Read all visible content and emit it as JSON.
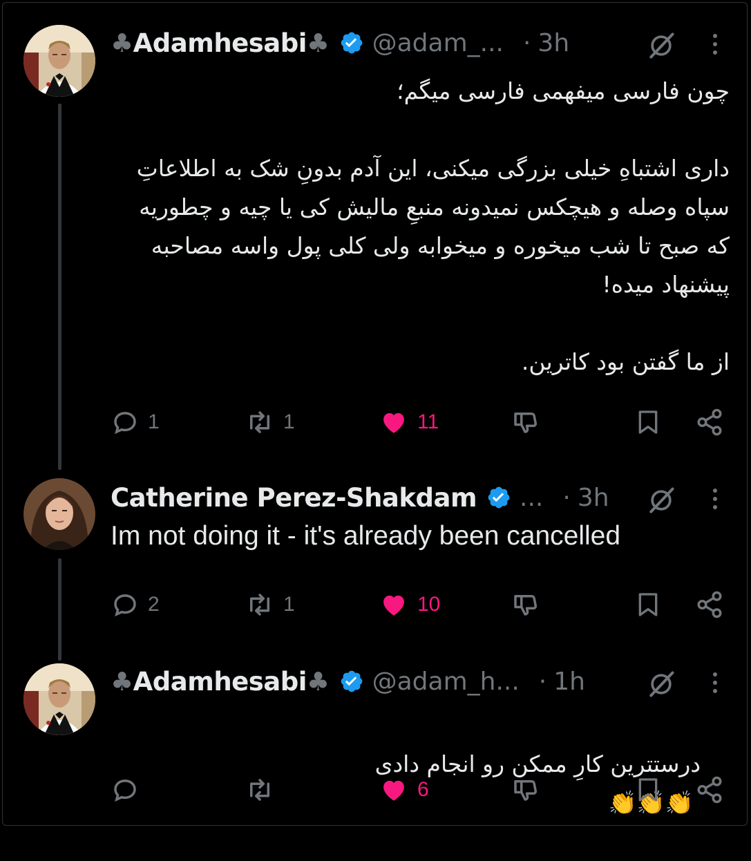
{
  "colors": {
    "background": "#000000",
    "text": "#e7e9ea",
    "muted": "#71767b",
    "verified": "#1d9bf0",
    "like": "#f91880",
    "thread_line": "#333639"
  },
  "tweets": [
    {
      "name_prefix": "♣",
      "name": "Adamhesabi",
      "name_suffix": "♣",
      "verified": true,
      "handle": "@adam_...",
      "dot": "·",
      "time": "3h",
      "avatar": "avatar-man-tuxedo",
      "text": "چون فارسی میفهمی فارسی میگم؛\n\nداری اشتباهِ خیلی بزرگی میکنی، این آدم بدونِ شک به اطلاعاتِ سپاه وصله و هیچکس نمیدونه منبعِ مالیش کی یا چیه و چطوریه که صبح تا شب میخوره و میخوابه ولی کلی پول واسه مصاحبه پیشنهاد میده!\n\nاز ما گفتن بود کاترین.",
      "replies": "1",
      "reposts": "1",
      "likes": "11"
    },
    {
      "name": "Catherine Perez-Shakdam",
      "verified": true,
      "handle": "...",
      "dot": "·",
      "time": "3h",
      "avatar": "avatar-woman",
      "text": "Im not doing it - it's already been cancelled",
      "replies": "2",
      "reposts": "1",
      "likes": "10"
    },
    {
      "name_prefix": "♣",
      "name": "Adamhesabi",
      "name_suffix": "♣",
      "verified": true,
      "handle": "@adam_h...",
      "dot": "·",
      "time": "1h",
      "avatar": "avatar-man-tuxedo",
      "text": "درستترین کارِ ممکن رو انجام دادی",
      "emoji": "👏👏👏",
      "replies": "",
      "reposts": "",
      "likes": "6"
    }
  ],
  "icons": {
    "reply": "reply-icon",
    "repost": "repost-icon",
    "like": "heart-icon",
    "dislike": "dislike-icon",
    "bookmark": "bookmark-icon",
    "share": "share-icon",
    "grok": "grok-icon",
    "more": "more-icon",
    "verified": "verified-badge-icon"
  }
}
